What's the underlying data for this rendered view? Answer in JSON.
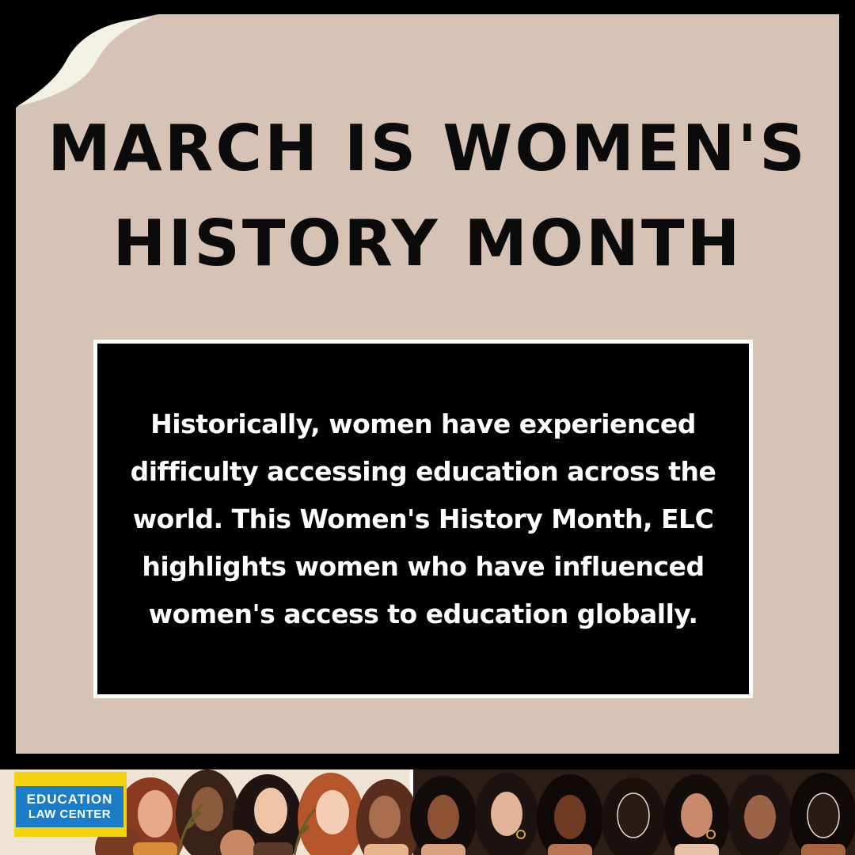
{
  "title": {
    "line1": "MARCH IS WOMEN'S",
    "line2": "HISTORY MONTH"
  },
  "message": {
    "text": "Historically, women have experienced difficulty accessing education across the world. This Women's History Month, ELC highlights women who have influenced women's access to education globally."
  },
  "logo": {
    "line1": "EDUCATION",
    "line2": "LAW CENTER"
  },
  "colors": {
    "background": "#000000",
    "paper": "#d6c3b6",
    "curl": "#f2f1e4",
    "title_text": "#0b0b0b",
    "message_box": "#000000",
    "message_border": "#ffffff",
    "logo_yellow": "#f5d20f",
    "logo_blue": "#1b7cc7"
  },
  "footer": {
    "artwork": "illustrated-crowd-of-diverse-women"
  }
}
